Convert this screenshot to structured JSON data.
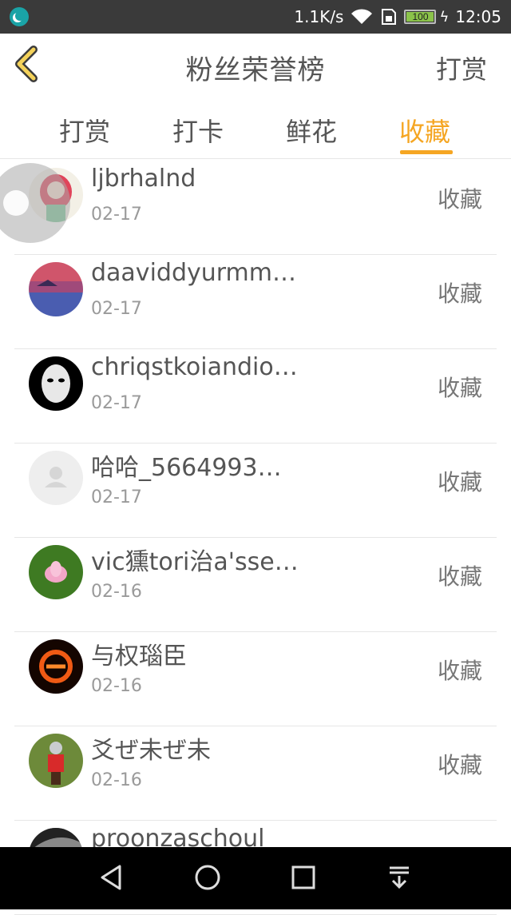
{
  "status_bar": {
    "speed": "1.1K/s",
    "battery": "100",
    "time": "12:05"
  },
  "header": {
    "title": "粉丝荣誉榜",
    "action": "打赏"
  },
  "tabs": [
    {
      "label": "打赏",
      "active": false
    },
    {
      "label": "打卡",
      "active": false
    },
    {
      "label": "鲜花",
      "active": false
    },
    {
      "label": "收藏",
      "active": true
    }
  ],
  "accent_color": "#f5a623",
  "list": [
    {
      "name": "ljbrhalnd",
      "date": "02-17",
      "action": "收藏",
      "avatar": "girl-avatar"
    },
    {
      "name": "daaviddyurmm…",
      "date": "02-17",
      "action": "收藏",
      "avatar": "sunset-avatar"
    },
    {
      "name": "chriqstkoiandio…",
      "date": "02-17",
      "action": "收藏",
      "avatar": "mask-avatar"
    },
    {
      "name": "哈哈_5664993…",
      "date": "02-17",
      "action": "收藏",
      "avatar": "default-avatar"
    },
    {
      "name": "vic獯tori治a'sse…",
      "date": "02-16",
      "action": "收藏",
      "avatar": "lotus-avatar"
    },
    {
      "name": "与权瑙臣",
      "date": "02-16",
      "action": "收藏",
      "avatar": "fire-e-avatar"
    },
    {
      "name": "爻ぜ未ぜ未",
      "date": "02-16",
      "action": "收藏",
      "avatar": "child-avatar"
    },
    {
      "name": "proonzaschoul",
      "date": "",
      "action": "",
      "avatar": "bw-avatar"
    }
  ]
}
